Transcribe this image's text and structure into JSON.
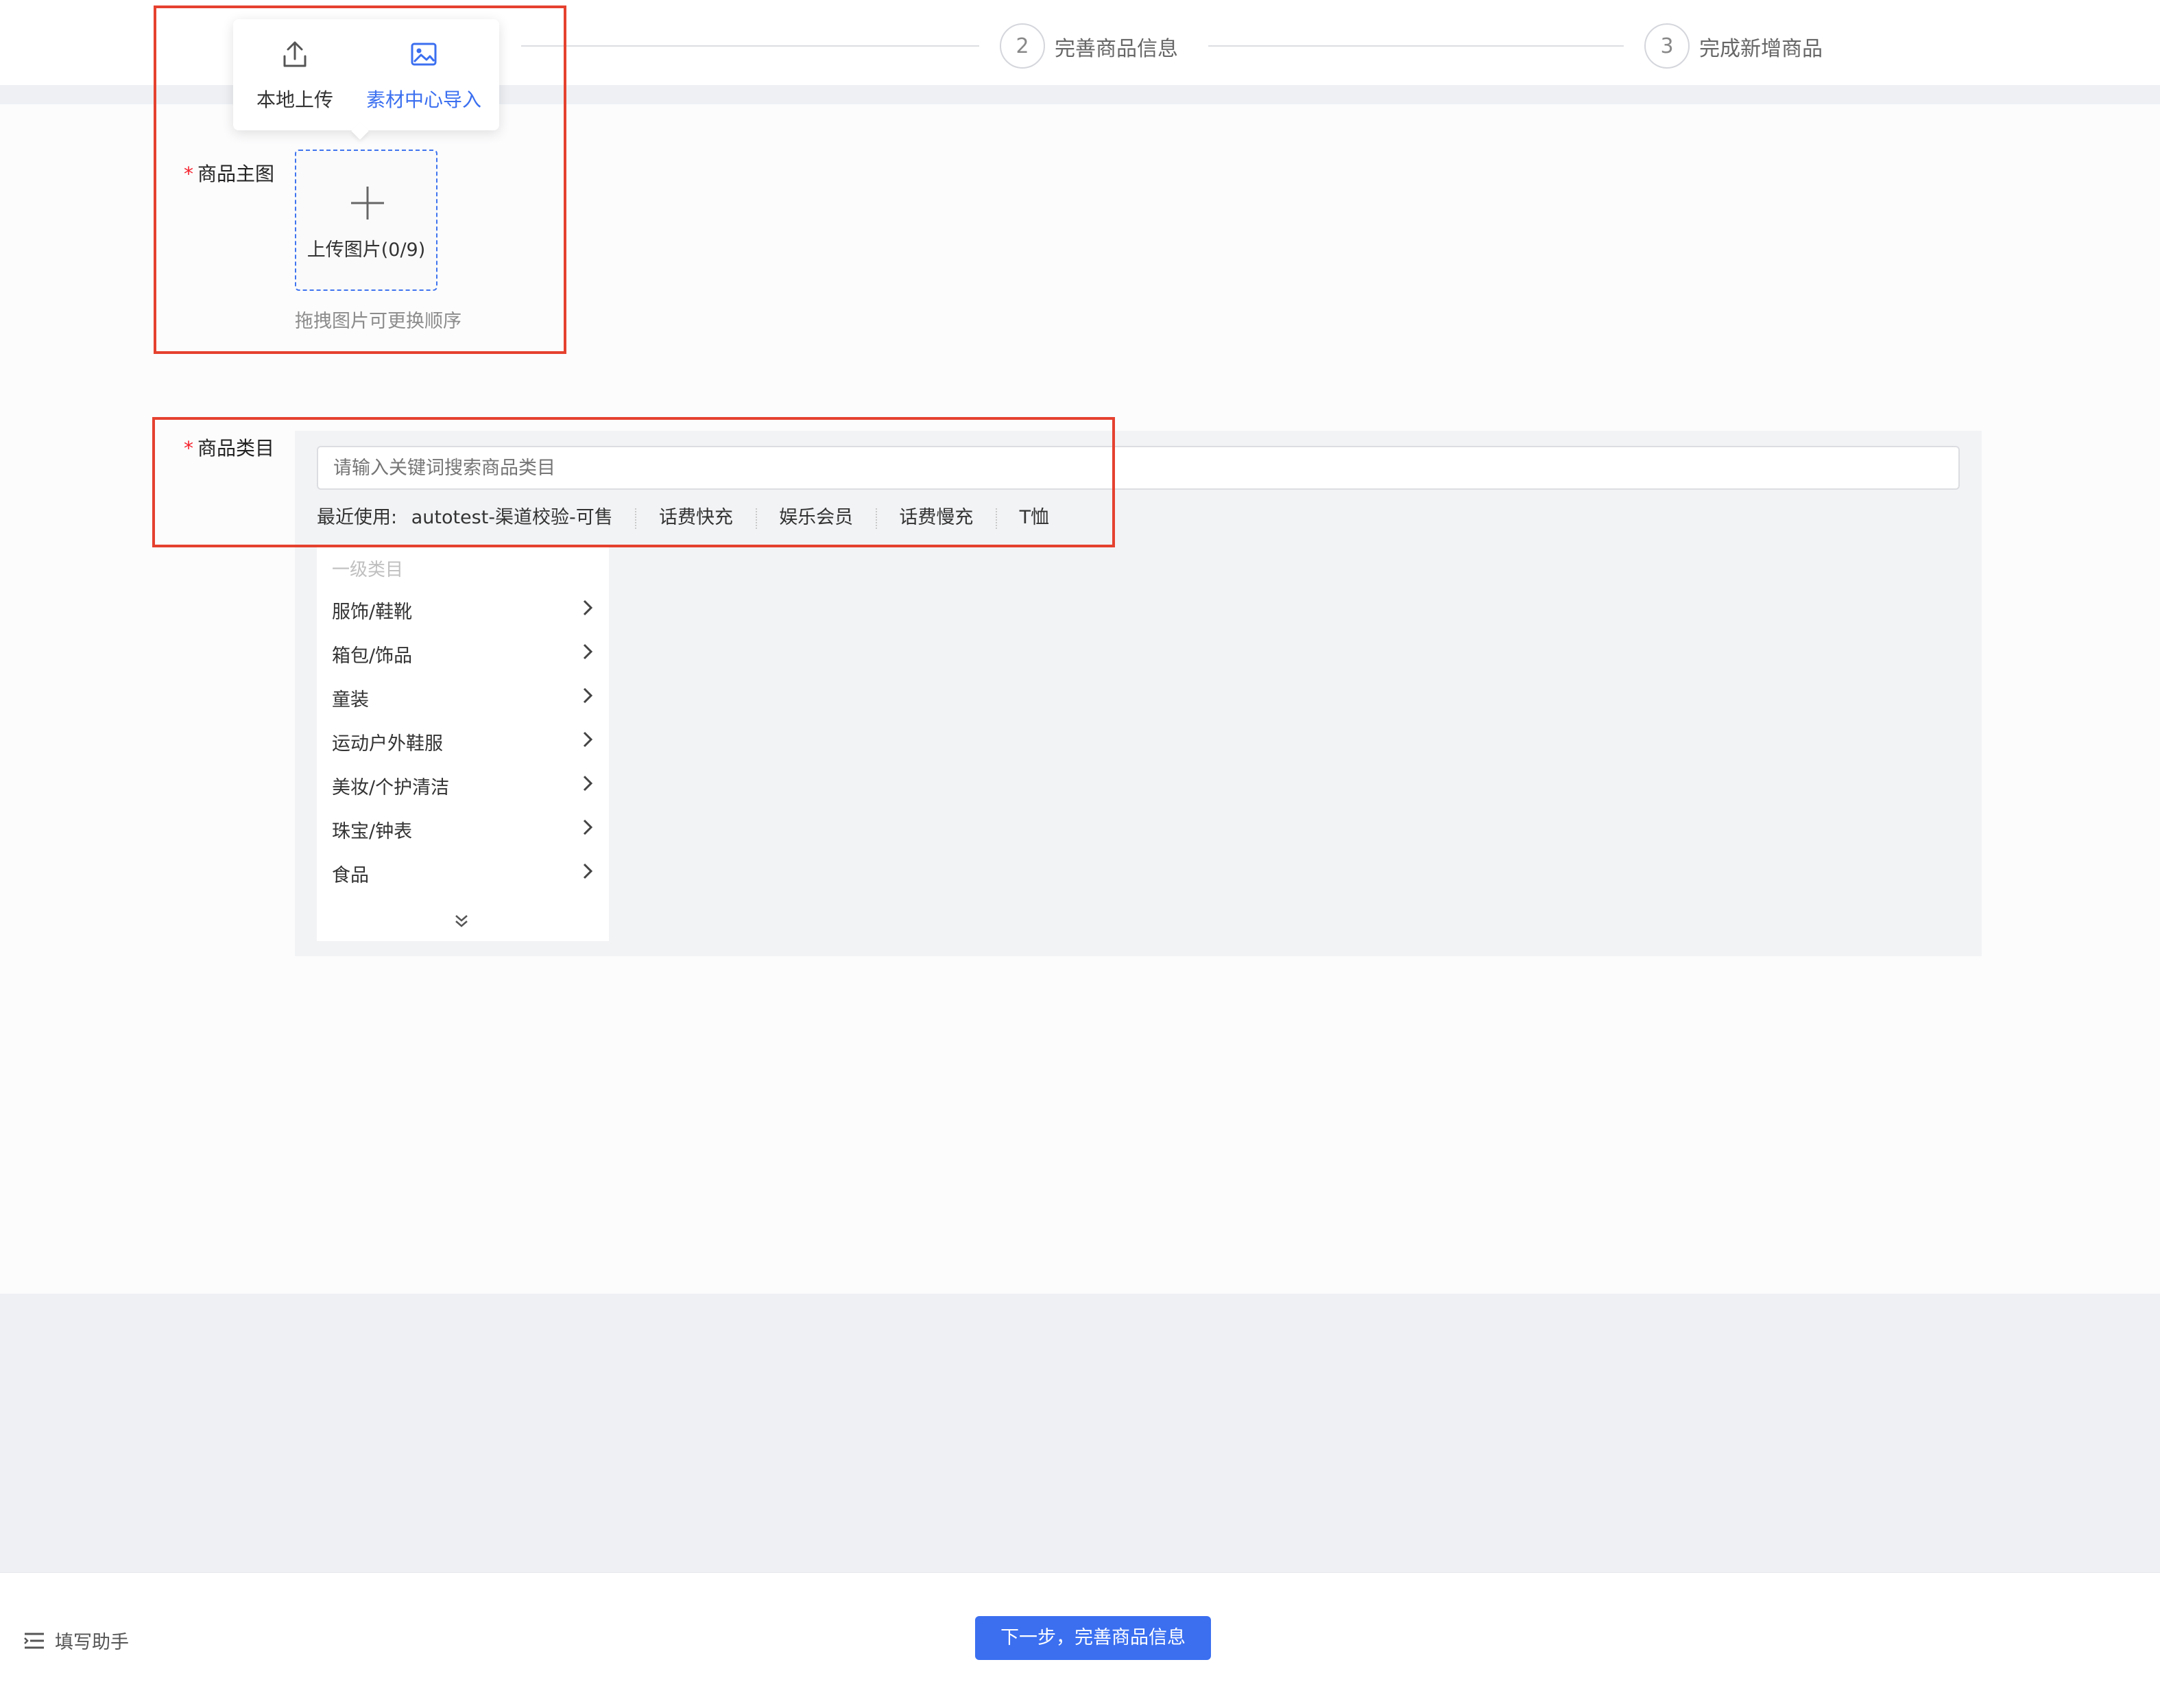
{
  "steps": [
    {
      "number": "2",
      "label": "完善商品信息"
    },
    {
      "number": "3",
      "label": "完成新增商品"
    }
  ],
  "upload_popover": {
    "local_upload": "本地上传",
    "material_import": "素材中心导入"
  },
  "main_image": {
    "label": "商品主图",
    "upload_text": "上传图片(0/9)",
    "hint": "拖拽图片可更换顺序"
  },
  "category": {
    "label": "商品类目",
    "search_placeholder": "请输入关键词搜索商品类目",
    "recent_label": "最近使用:",
    "recent_items": [
      "autotest-渠道校验-可售",
      "话费快充",
      "娱乐会员",
      "话费慢充",
      "T恤"
    ],
    "level_header": "一级类目",
    "items": [
      "服饰/鞋靴",
      "箱包/饰品",
      "童装",
      "运动户外鞋服",
      "美妆/个护清洁",
      "珠宝/钟表",
      "食品"
    ]
  },
  "footer": {
    "helper_label": "填写助手",
    "next_button": "下一步，完善商品信息"
  },
  "colors": {
    "primary": "#3b6ff0",
    "annotation_red": "#e5412f",
    "required_star": "#f5222d"
  }
}
